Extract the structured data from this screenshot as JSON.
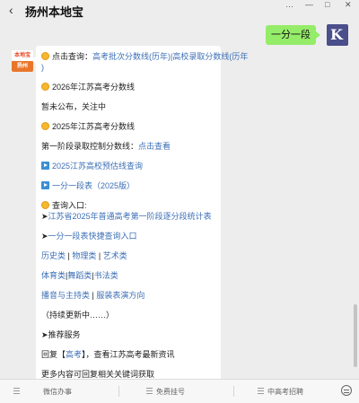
{
  "window": {
    "title": "扬州本地宝",
    "back_icon": "chevron-left-icon",
    "controls": [
      "…",
      "—",
      "□",
      "✕"
    ]
  },
  "chat": {
    "my_message": "一分一段",
    "my_avatar_icon": "user-avatar-icon",
    "their_avatar": {
      "top_text": "本地宝",
      "bottom_text": "扬州"
    },
    "reply": {
      "line1_prefix": "点击查询：",
      "line1_link_a": "高考批次分数线(历年)",
      "line1_sep": "|",
      "line1_link_b": "高校录取分数线(历年",
      "line1_cont": ")",
      "line2": "2026年江苏高考分数线",
      "line3": "暂未公布，关注中",
      "line4": "2025年江苏高考分数线",
      "line5_prefix": "第一阶段录取控制分数线：",
      "line5_link": "点击查看",
      "line6_link": "2025江苏高校预估线查询",
      "line7_link": "一分一段表（2025版）",
      "line8": "查询入口:",
      "line9_arrow": "➤",
      "line9_link": "江苏省2025年普通高考第一阶段逐分段统计表",
      "line10_arrow": "➤",
      "line10_link": "一分一段表快捷查询入口",
      "line11_a": "历史类",
      "line11_sep1": " | ",
      "line11_b": "物理类",
      "line11_sep2": " | ",
      "line11_c": "艺术类",
      "line12_a": "体育类",
      "line12_sep1": "|",
      "line12_b": "舞蹈类",
      "line12_sep2": "|",
      "line12_c": "书法类",
      "line13_a": "播音与主持类",
      "line13_sep": " | ",
      "line13_b": "服装表演方向",
      "line14": "（持续更新中……）",
      "line15": "➤推荐服务",
      "line16_a": "回复【",
      "line16_link": "高考",
      "line16_b": "】，查看江苏高考最新资讯",
      "line17": "更多内容可回复相关关键词获取"
    }
  },
  "footer": {
    "items": [
      "微信办事",
      "免费挂号",
      "中高考招聘"
    ],
    "keyboard_icon": "keyboard-icon"
  }
}
